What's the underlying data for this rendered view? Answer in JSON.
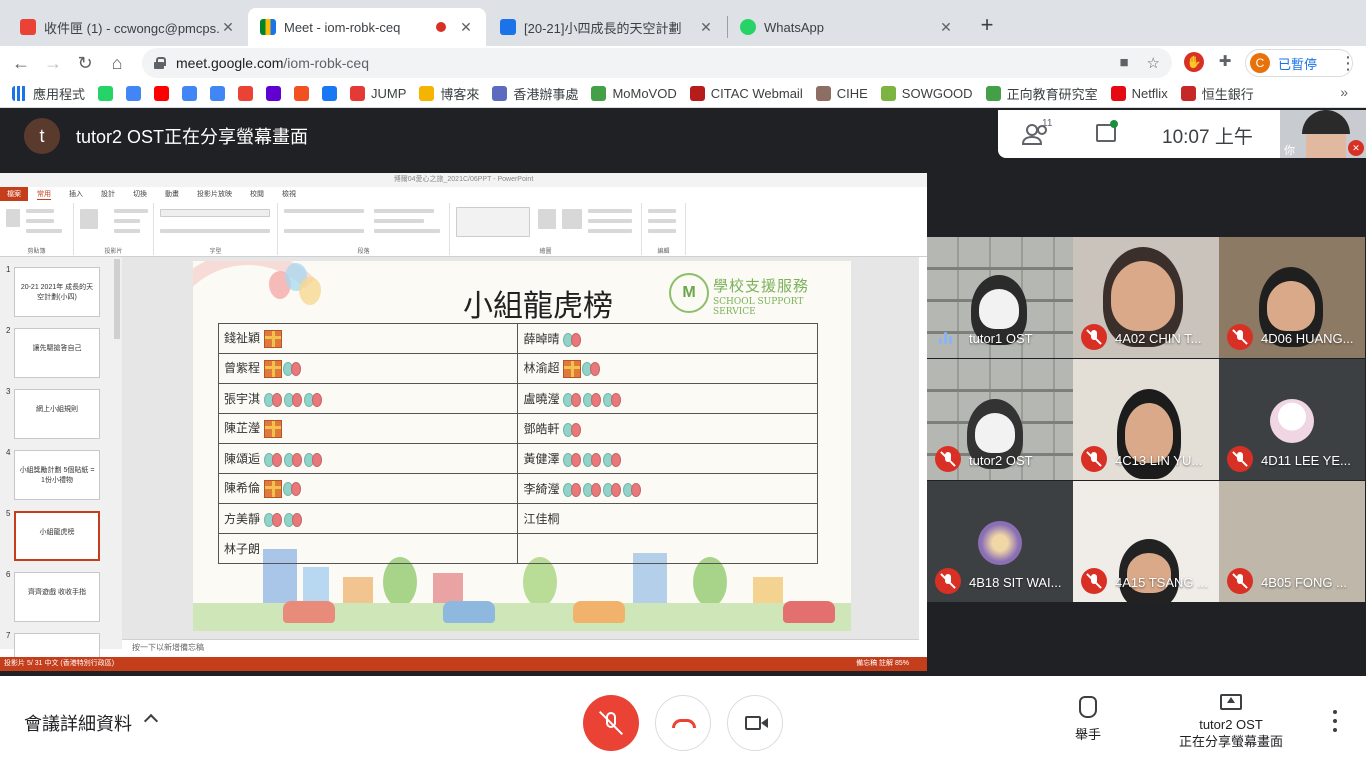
{
  "browser": {
    "tabs": [
      {
        "title": "收件匣 (1) - ccwongc@pmcps.e",
        "favicon": "gmail-icon"
      },
      {
        "title": "Meet - iom-robk-ceq",
        "favicon": "meet-icon",
        "active": true,
        "recording": true
      },
      {
        "title": "[20-21]小四成長的天空計劃",
        "favicon": "classroom-icon"
      },
      {
        "title": "WhatsApp",
        "favicon": "whatsapp-icon"
      }
    ],
    "url_host": "meet.google.com",
    "url_path": "/iom-robk-ceq",
    "profile_initial": "C",
    "profile_status": "已暫停",
    "bookmarks": [
      {
        "label": "應用程式",
        "icon": "apps-grid-icon"
      },
      {
        "label": "",
        "icon": "whatsapp-icon"
      },
      {
        "label": "",
        "icon": "google-icon"
      },
      {
        "label": "",
        "icon": "youtube-icon"
      },
      {
        "label": "",
        "icon": "calendar-icon"
      },
      {
        "label": "",
        "icon": "google-icon"
      },
      {
        "label": "",
        "icon": "gmail-icon"
      },
      {
        "label": "",
        "icon": "yahoo-icon"
      },
      {
        "label": "",
        "icon": "microsoft-icon"
      },
      {
        "label": "",
        "icon": "facebook-icon"
      },
      {
        "label": "JUMP",
        "icon": "jump-icon"
      },
      {
        "label": "博客來",
        "icon": "books-icon"
      },
      {
        "label": "香港辦事處",
        "icon": "office-icon"
      },
      {
        "label": "MoMoVOD",
        "icon": "momovod-icon"
      },
      {
        "label": "CITAC Webmail",
        "icon": "citac-icon"
      },
      {
        "label": "CIHE",
        "icon": "cihe-icon"
      },
      {
        "label": "SOWGOOD",
        "icon": "sowgood-icon"
      },
      {
        "label": "正向教育研究室",
        "icon": "puzzle-icon"
      },
      {
        "label": "Netflix",
        "icon": "netflix-icon"
      },
      {
        "label": "恒生銀行",
        "icon": "hangseng-icon"
      }
    ]
  },
  "meet": {
    "presenter_initial": "t",
    "presenter_text": "tutor2 OST正在分享螢幕畫面",
    "participant_count": "11",
    "time": "10:07 上午",
    "self_label": "你",
    "details_label": "會議詳細資料",
    "raise_hand_label": "舉手",
    "presenting_line1": "tutor2 OST",
    "presenting_line2": "正在分享螢幕畫面",
    "participants": [
      {
        "name": "tutor1 OST",
        "muted": false
      },
      {
        "name": "4A02 CHIN T...",
        "muted": true
      },
      {
        "name": "4D06 HUANG...",
        "muted": true
      },
      {
        "name": "tutor2 OST",
        "muted": true
      },
      {
        "name": "4C13 LIN YU...",
        "muted": true
      },
      {
        "name": "4D11 LEE YE...",
        "muted": true
      },
      {
        "name": "4B18 SIT WAI...",
        "muted": true
      },
      {
        "name": "4A15 TSANG ...",
        "muted": true
      },
      {
        "name": "4B05 FONG ...",
        "muted": true
      }
    ]
  },
  "ppt": {
    "window_title": "博爾04愛心之旅_2021C/06PPT - PowerPoint",
    "ribbon_tabs": [
      "檔案",
      "常用",
      "插入",
      "設計",
      "切換",
      "動畫",
      "投影片放映",
      "校閱",
      "檢視"
    ],
    "ribbon_groups": [
      "剪貼簿",
      "投影片",
      "字型",
      "段落",
      "繪圖",
      "編輯"
    ],
    "notes_placeholder": "按一下以新增備忘稿",
    "status_left": "投影片 5/ 31   中文 (香港特別行政區)",
    "status_right": "備忘稿  註解   85%",
    "thumbnails": [
      {
        "num": "1",
        "text": "20-21 2021年 成長的天空計劃(小四)"
      },
      {
        "num": "2",
        "text": "讓先驅搶答自己"
      },
      {
        "num": "3",
        "text": "網上小組規則"
      },
      {
        "num": "4",
        "text": "小組獎勵計劃 5個貼紙 = 1份小禮物"
      },
      {
        "num": "5",
        "text": "小組龍虎榜"
      },
      {
        "num": "6",
        "text": "齊齊遊戲 收收手指"
      },
      {
        "num": "7",
        "text": ""
      }
    ],
    "slide": {
      "title": "小組龍虎榜",
      "logo_zh": "學校支援服務",
      "logo_en": "SCHOOL SUPPORT SERVICE",
      "rows": [
        [
          {
            "name": "錢祉穎",
            "stickers": [
              "gift"
            ]
          },
          {
            "name": "薛晫晴",
            "stickers": [
              "bal"
            ]
          }
        ],
        [
          {
            "name": "曾紫程",
            "stickers": [
              "gift",
              "bal"
            ]
          },
          {
            "name": "林渝超",
            "stickers": [
              "gift",
              "bal"
            ]
          }
        ],
        [
          {
            "name": "張宇淇",
            "stickers": [
              "bal",
              "bal",
              "bal"
            ]
          },
          {
            "name": "盧曉瀅",
            "stickers": [
              "bal",
              "bal",
              "bal"
            ]
          }
        ],
        [
          {
            "name": "陳芷瀅",
            "stickers": [
              "gift"
            ]
          },
          {
            "name": "鄧皓軒",
            "stickers": [
              "bal"
            ]
          }
        ],
        [
          {
            "name": "陳頌逅",
            "stickers": [
              "bal",
              "bal",
              "bal"
            ]
          },
          {
            "name": "黃健澤",
            "stickers": [
              "bal",
              "bal",
              "bal"
            ]
          }
        ],
        [
          {
            "name": "陳希倫",
            "stickers": [
              "gift",
              "bal"
            ]
          },
          {
            "name": "李綺瀅",
            "stickers": [
              "bal",
              "bal",
              "bal",
              "bal"
            ]
          }
        ],
        [
          {
            "name": "方美靜",
            "stickers": [
              "bal",
              "bal"
            ]
          },
          {
            "name": "江佳桐",
            "stickers": []
          }
        ],
        [
          {
            "name": "林子朗",
            "stickers": []
          },
          {
            "name": "",
            "stickers": []
          }
        ]
      ]
    }
  }
}
